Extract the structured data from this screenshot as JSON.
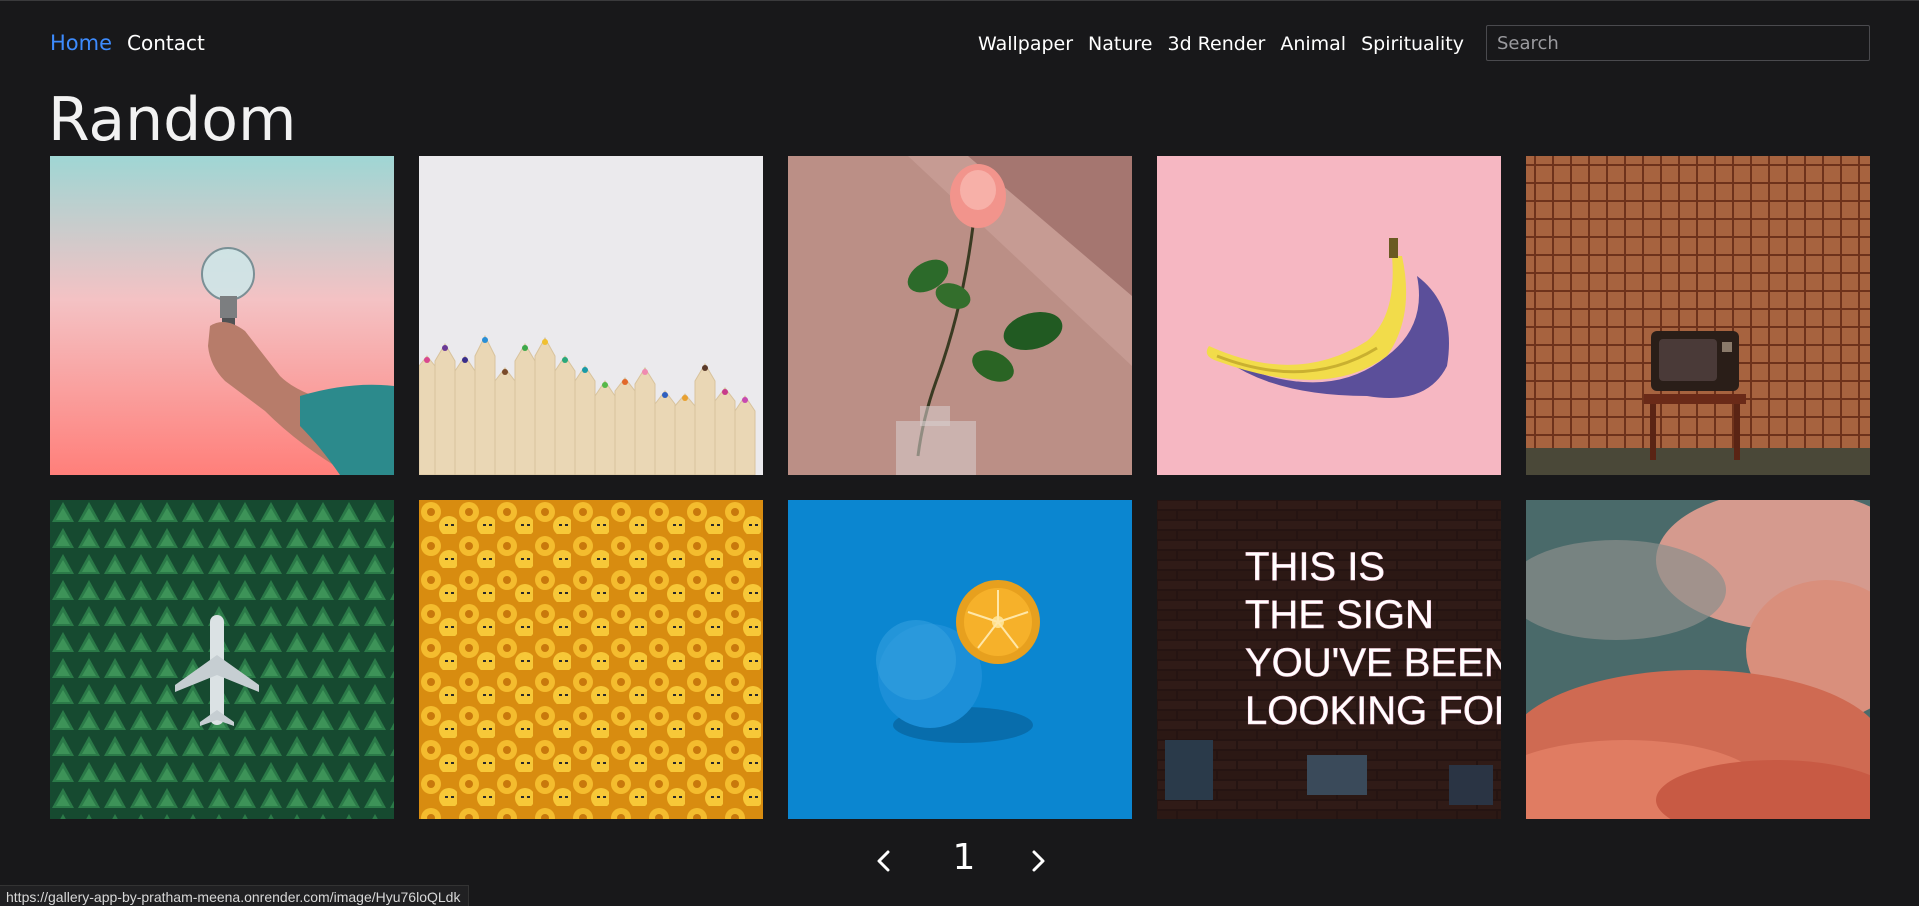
{
  "nav": {
    "home": "Home",
    "contact": "Contact",
    "categories": [
      "Wallpaper",
      "Nature",
      "3d Render",
      "Animal",
      "Spirituality"
    ],
    "search_placeholder": "Search",
    "active_color": "#3d8bfd"
  },
  "page": {
    "title": "Random"
  },
  "gallery": {
    "images": [
      {
        "subject": "hand holding light bulb",
        "bg": "#ff8d86"
      },
      {
        "subject": "colored pencils",
        "bg": "#ecebee"
      },
      {
        "subject": "pink rose in glass vase",
        "bg": "#b58a82"
      },
      {
        "subject": "banana on pink",
        "bg": "#f6b7c2"
      },
      {
        "subject": "retro tv on chair",
        "bg": "#a9663f"
      },
      {
        "subject": "airplane in pine forest",
        "bg": "#1f5a3a"
      },
      {
        "subject": "yellow toy heads",
        "bg": "#f0b52c"
      },
      {
        "subject": "blue orange on blue",
        "bg": "#0b86d0"
      },
      {
        "subject": "neon sign on brick wall",
        "bg": "#2a1e1e"
      },
      {
        "subject": "pink clouds",
        "bg": "#b06a5a"
      }
    ],
    "neon_text": [
      "THIS IS",
      "THE SIGN",
      "YOU'VE BEEN",
      "LOOKING FOR"
    ]
  },
  "pagination": {
    "current_page": "1",
    "prev_icon": "chevron-left-icon",
    "next_icon": "chevron-right-icon"
  },
  "status": {
    "url": "https://gallery-app-by-pratham-meena.onrender.com/image/Hyu76loQLdk"
  }
}
